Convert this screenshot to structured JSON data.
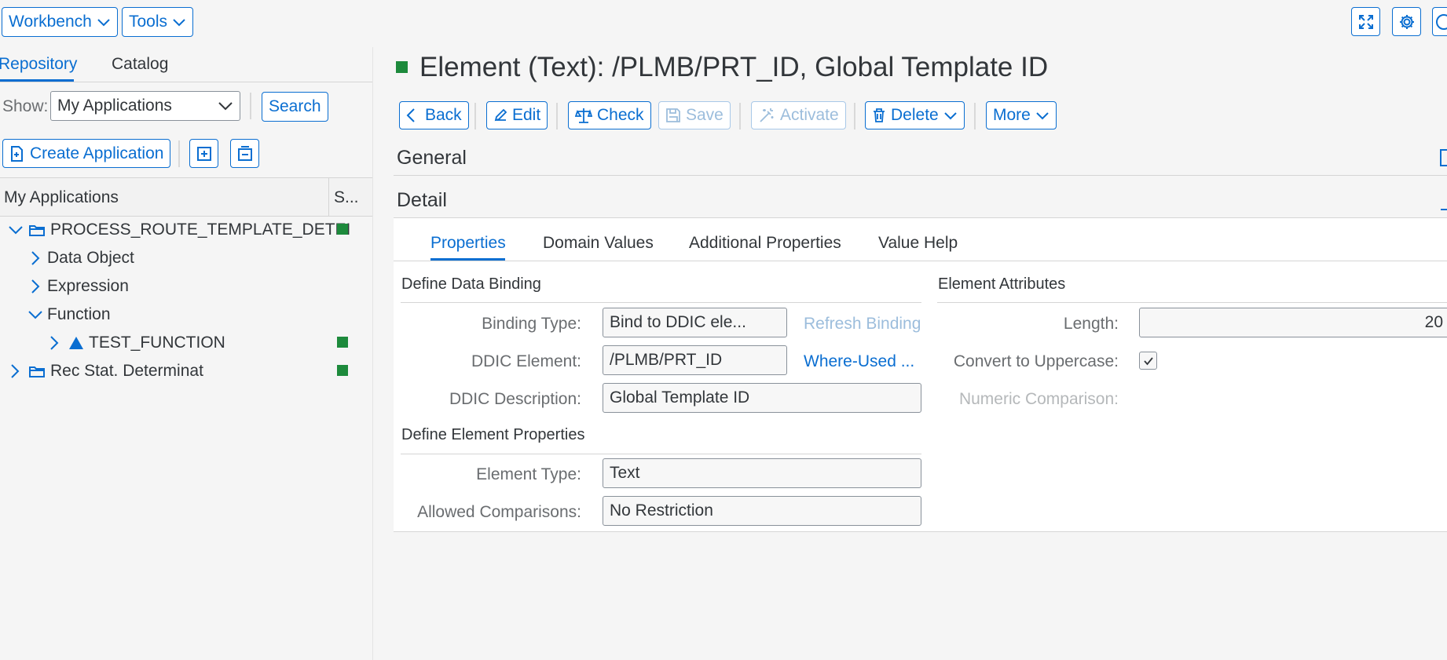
{
  "topbar": {
    "workbench_label": "Workbench",
    "tools_label": "Tools"
  },
  "left": {
    "tabs": [
      "Repository",
      "Catalog"
    ],
    "active_tab": 0,
    "show_label": "Show:",
    "show_value": "My Applications",
    "search_label": "Search",
    "create_app_label": "Create Application",
    "tree_header": "My Applications",
    "tree_header_status": "S...",
    "tree": [
      {
        "label": "PROCESS_ROUTE_TEMPLATE_DETEI",
        "expanded": true,
        "status": "green"
      },
      {
        "label": "Data Object",
        "expanded": false
      },
      {
        "label": "Expression",
        "expanded": false
      },
      {
        "label": "Function",
        "expanded": true
      },
      {
        "label": "TEST_FUNCTION",
        "expanded": false,
        "status": "green"
      },
      {
        "label": "Rec Stat. Determinat",
        "expanded": false,
        "status": "green"
      }
    ]
  },
  "main": {
    "title": "Element (Text): /PLMB/PRT_ID, Global Template ID",
    "status_color": "#1d8a3c",
    "toolbar": {
      "back": "Back",
      "edit": "Edit",
      "check": "Check",
      "save": "Save",
      "activate": "Activate",
      "delete": "Delete",
      "more": "More"
    },
    "section_general": "General",
    "section_detail": "Detail",
    "tabs": [
      "Properties",
      "Domain Values",
      "Additional Properties",
      "Value Help"
    ],
    "active_tab": 0,
    "binding": {
      "heading": "Define Data Binding",
      "binding_type_label": "Binding Type:",
      "binding_type_value": "Bind to DDIC ele...",
      "refresh_binding": "Refresh Binding",
      "ddic_element_label": "DDIC Element:",
      "ddic_element_value": "/PLMB/PRT_ID",
      "where_used": "Where-Used ...",
      "ddic_description_label": "DDIC Description:",
      "ddic_description_value": "Global Template ID"
    },
    "element_props": {
      "heading": "Define Element Properties",
      "element_type_label": "Element Type:",
      "element_type_value": "Text",
      "allowed_comparisons_label": "Allowed Comparisons:",
      "allowed_comparisons_value": "No Restriction"
    },
    "attributes": {
      "heading": "Element Attributes",
      "length_label": "Length:",
      "length_value": "20",
      "uppercase_label": "Convert to Uppercase:",
      "uppercase_checked": true,
      "numeric_label": "Numeric Comparison:"
    }
  },
  "colors": {
    "accent": "#0a6ed1",
    "status_green": "#1d8a3c",
    "background": "#f5f5f5"
  }
}
